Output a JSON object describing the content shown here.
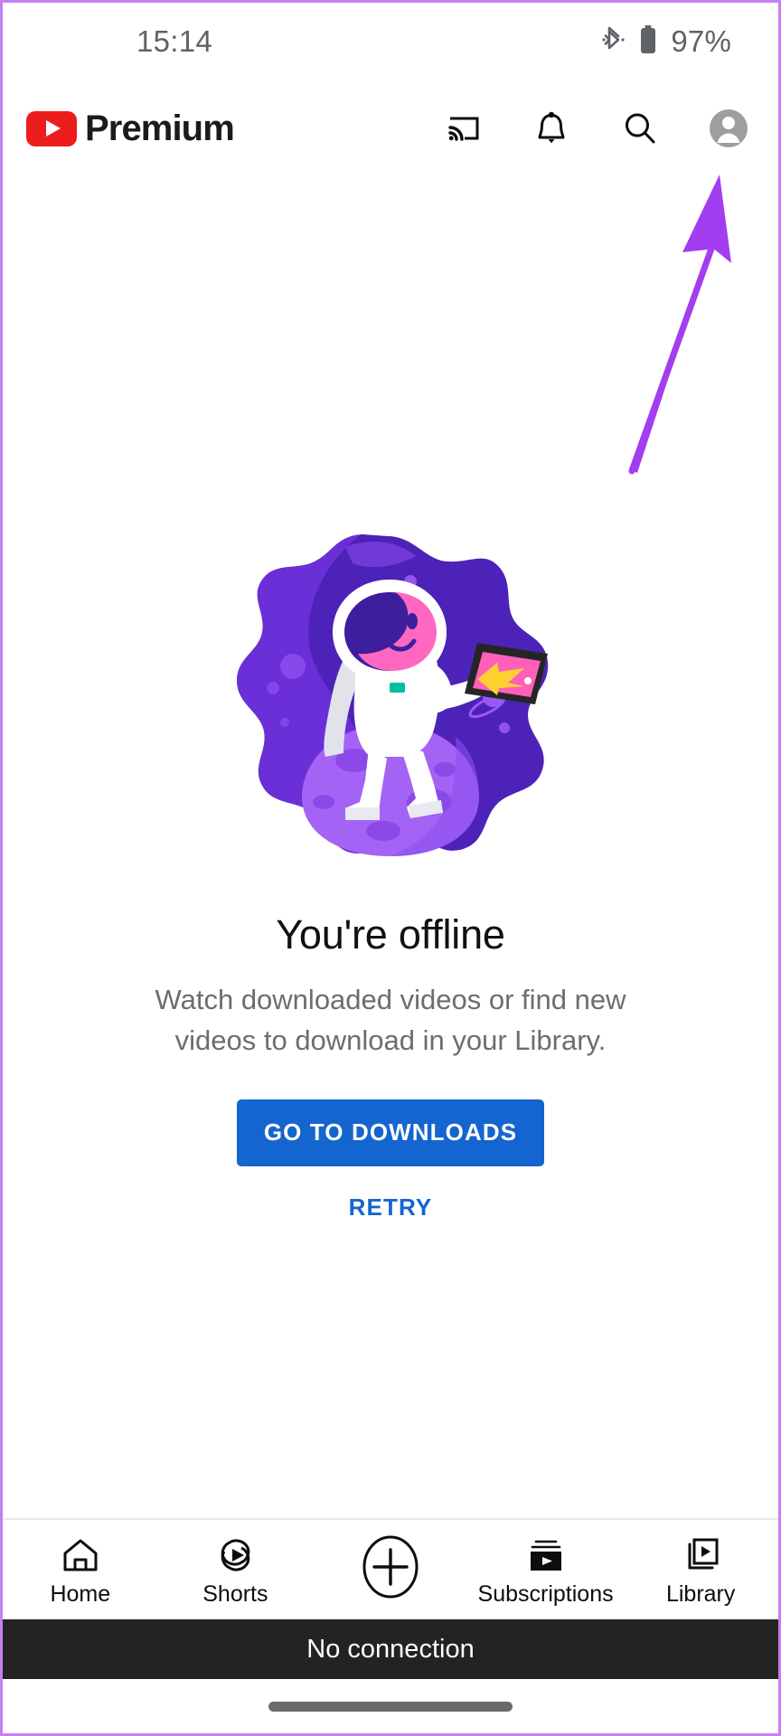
{
  "status_bar": {
    "time": "15:14",
    "bluetooth_icon": "bluetooth-icon",
    "battery_icon": "battery-icon",
    "battery_percent": "97%"
  },
  "header": {
    "logo_icon": "youtube-play-icon",
    "brand_word": "Premium",
    "actions": [
      {
        "name": "cast-icon",
        "label": "Cast"
      },
      {
        "name": "notifications-bell-icon",
        "label": "Notifications"
      },
      {
        "name": "search-icon",
        "label": "Search"
      },
      {
        "name": "account-avatar-icon",
        "label": "Account"
      }
    ]
  },
  "annotation": {
    "arrow_icon": "purple-arrow-annotation",
    "color": "#a23df0",
    "points_to": "account-avatar-icon"
  },
  "main": {
    "illustration": "astronaut-on-planet-illustration",
    "headline": "You're offline",
    "subtext": "Watch downloaded videos or find new videos to download in your Library.",
    "primary_button": "GO TO DOWNLOADS",
    "secondary_button": "RETRY",
    "primary_button_color": "#1565D0"
  },
  "bottom_nav": {
    "items": [
      {
        "label": "Home",
        "icon": "home-icon",
        "active": false
      },
      {
        "label": "Shorts",
        "icon": "shorts-icon",
        "active": false
      },
      {
        "label": "",
        "icon": "create-plus-icon",
        "active": false
      },
      {
        "label": "Subscriptions",
        "icon": "subscriptions-icon",
        "active": false
      },
      {
        "label": "Library",
        "icon": "library-icon",
        "active": false
      }
    ]
  },
  "toast": {
    "message": "No connection",
    "background": "#232323"
  },
  "gesture_bar": {
    "icon": "home-gesture-bar"
  },
  "illustration_colors": {
    "blob_dark": "#4b22b5",
    "blob_mid": "#6a2fd6",
    "blob_light": "#8c4ef0",
    "planet": "#a463f5",
    "planet_crater": "#8b4ae8",
    "suit": "#ffffff",
    "suit_shadow": "#e2e2ea",
    "visor": "#3d1f9e",
    "face": "#ff67c0",
    "tablet_frame": "#252525",
    "tablet_screen": "#ff5fb8",
    "rocket": "#ffd130"
  }
}
